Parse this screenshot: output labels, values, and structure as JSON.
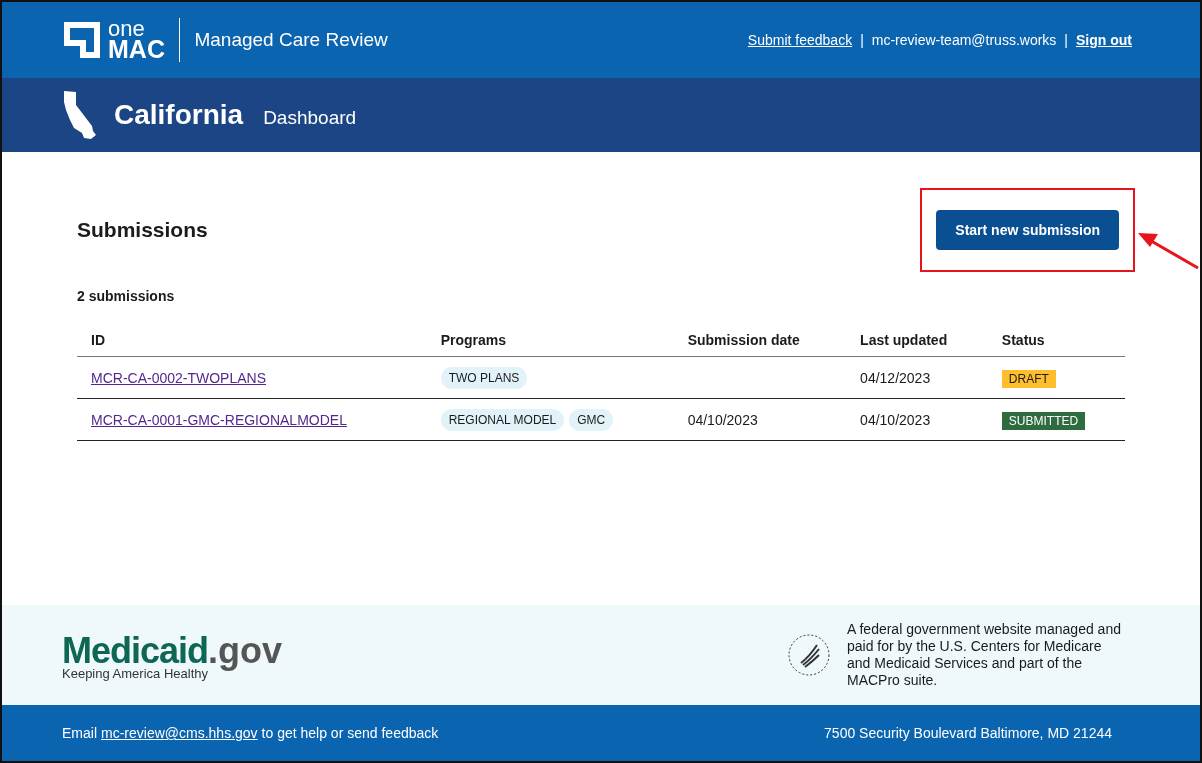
{
  "header": {
    "logo_top": "one",
    "logo_bottom": "MAC",
    "app_title": "Managed Care Review",
    "links": [
      {
        "kind": "link",
        "text": "Submit feedback"
      },
      {
        "kind": "separator",
        "text": "|"
      },
      {
        "kind": "text",
        "text": "mc-review-team@truss.works"
      },
      {
        "kind": "separator",
        "text": "|"
      },
      {
        "kind": "link",
        "text": "Sign out"
      }
    ]
  },
  "subheader": {
    "state": "California",
    "page": "Dashboard"
  },
  "submissions": {
    "title": "Submissions",
    "count": "2 submissions",
    "new_button": {
      "label": "Start new submission",
      "highlighted": true
    },
    "columns": [
      "ID",
      "Programs",
      "Submission date",
      "Last updated",
      "Status"
    ],
    "rows": [
      {
        "id": "MCR-CA-0002-TWOPLANS",
        "programs": [
          "TWO PLANS"
        ],
        "updated": "04/12/2023",
        "status": "DRAFT",
        "kind": "draft"
      },
      {
        "id": "MCR-CA-0001-GMC-REGIONALMODEL",
        "programs": [
          "REGIONAL MODEL",
          "GMC"
        ],
        "submitted": "04/10/2023",
        "updated": "04/10/2023",
        "status": "SUBMITTED",
        "kind": "submitted"
      }
    ]
  },
  "footer": {
    "brand": "Medicaid",
    "brand_suffix": ".gov",
    "tagline": "Keeping America Healthy",
    "notice": "A federal government website managed and paid for by the U.S. Centers for Medicare and Medicaid Services and part of the MACPro suite.",
    "email_prefix": "Email",
    "email": "mc-review@cms.hhs.gov",
    "email_suffix": "to get help or send feedback",
    "address": "7500 Security Boulevard Baltimore, MD 21244"
  }
}
